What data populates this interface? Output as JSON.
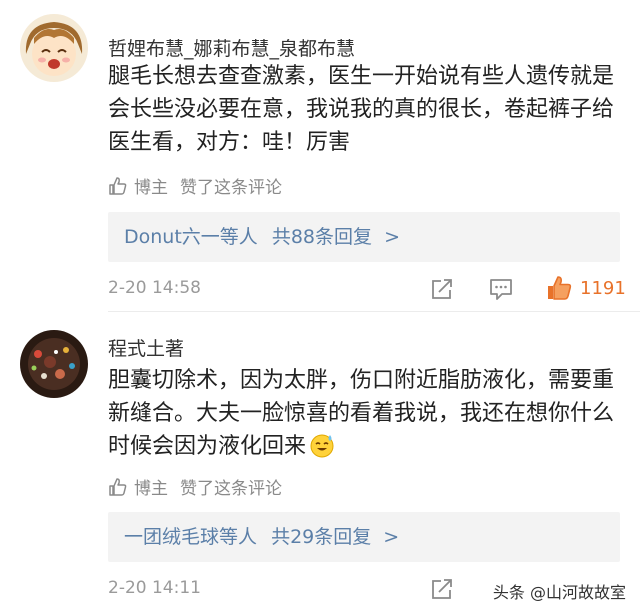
{
  "comments": [
    {
      "username": "哲娌布慧_娜莉布慧_泉都布慧",
      "text": "腿毛长想去查查激素，医生一开始说有些人遗传就是会长些没必要在意，我说我的真的很长，卷起裤子给医生看，对方：哇！厉害",
      "liked_by": "博主",
      "liked_action": "赞了这条评论",
      "replies_summary": "Donut六一等人",
      "replies_count": "共88条回复",
      "replies_arrow": ">",
      "time": "2-20 14:58",
      "likes": "1191"
    },
    {
      "username": "程式土著",
      "text": "胆囊切除术，因为太胖，伤口附近脂肪液化，需要重新缝合。大夫一脸惊喜的看着我说，我还在想你什么时候会因为液化回来",
      "emoji": "sweat-smile-emoji",
      "liked_by": "博主",
      "liked_action": "赞了这条评论",
      "replies_summary": "一团绒毛球等人",
      "replies_count": "共29条回复",
      "replies_arrow": ">",
      "time": "2-20 14:11"
    }
  ],
  "watermark": "头条 @山河故故室",
  "colors": {
    "link": "#5b7fa8",
    "like_active": "#e8722a",
    "meta": "#9a9a9a"
  },
  "icons": [
    "thumbs-up-icon",
    "share-icon",
    "comment-icon",
    "like-icon"
  ]
}
